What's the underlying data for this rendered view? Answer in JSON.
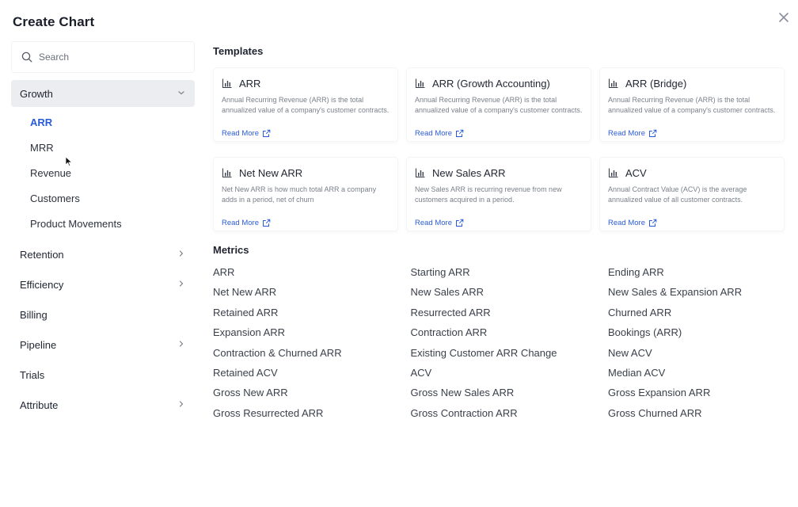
{
  "modal": {
    "title": "Create Chart"
  },
  "search": {
    "placeholder": "Search"
  },
  "sidebar": {
    "categories": [
      {
        "label": "Growth",
        "expanded": true,
        "sub": [
          "ARR",
          "MRR",
          "Revenue",
          "Customers",
          "Product Movements"
        ],
        "active_sub": "ARR"
      },
      {
        "label": "Retention",
        "has_children": true
      },
      {
        "label": "Efficiency",
        "has_children": true
      },
      {
        "label": "Billing",
        "has_children": false
      },
      {
        "label": "Pipeline",
        "has_children": true
      },
      {
        "label": "Trials",
        "has_children": false
      },
      {
        "label": "Attribute",
        "has_children": true
      }
    ]
  },
  "templates": {
    "heading": "Templates",
    "read_more": "Read More",
    "cards": [
      {
        "name": "ARR",
        "desc": "Annual Recurring Revenue (ARR) is the total annualized value of a company's customer contracts."
      },
      {
        "name": "ARR (Growth Accounting)",
        "desc": "Annual Recurring Revenue (ARR) is the total annualized value of a company's customer contracts."
      },
      {
        "name": "ARR (Bridge)",
        "desc": "Annual Recurring Revenue (ARR) is the total annualized value of a company's customer contracts."
      },
      {
        "name": "Net New ARR",
        "desc": "Net New ARR is how much total ARR a company adds in a period, net of churn"
      },
      {
        "name": "New Sales ARR",
        "desc": "New Sales ARR is recurring revenue from new customers acquired in a period."
      },
      {
        "name": "ACV",
        "desc": "Annual Contract Value (ACV) is the average annualized value of all customer contracts."
      }
    ]
  },
  "metrics": {
    "heading": "Metrics",
    "columns": [
      [
        "ARR",
        "Net New ARR",
        "Retained ARR",
        "Expansion ARR",
        "Contraction & Churned ARR",
        "Retained ACV",
        "Gross New ARR",
        "Gross Resurrected ARR"
      ],
      [
        "Starting ARR",
        "New Sales ARR",
        "Resurrected ARR",
        "Contraction ARR",
        "Existing Customer ARR Change",
        "ACV",
        "Gross New Sales ARR",
        "Gross Contraction ARR"
      ],
      [
        "Ending ARR",
        "New Sales & Expansion ARR",
        "Churned ARR",
        "Bookings (ARR)",
        "New ACV",
        "Median ACV",
        "Gross Expansion ARR",
        "Gross Churned ARR"
      ]
    ]
  },
  "colors": {
    "accent": "#2a5bd7",
    "active_bg": "#ebedf1",
    "text": "#1f2430",
    "muted": "#7a7f8a"
  },
  "icons": {
    "search": "search-icon",
    "close": "close-icon",
    "chart": "bar-chart-icon",
    "external": "external-link-icon",
    "chevron_right": "chevron-right-icon",
    "chevron_down": "chevron-down-icon"
  }
}
